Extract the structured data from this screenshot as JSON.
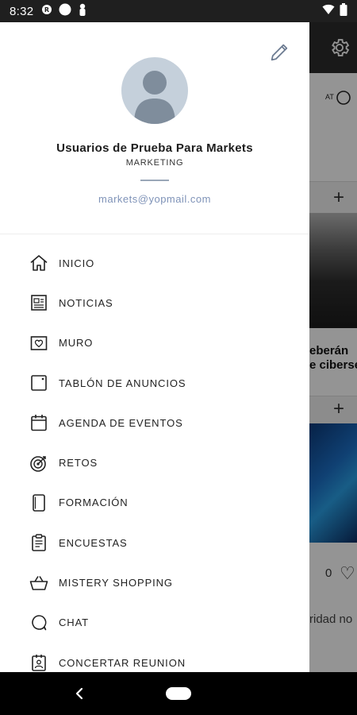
{
  "status_bar": {
    "time": "8:32"
  },
  "background_app": {
    "card_title_line1": "eberán",
    "card_title_line2": "e ciberse",
    "likes_count": "0",
    "snippet": "ridad no"
  },
  "drawer": {
    "user": {
      "name": "Usuarios de Prueba Para Markets",
      "department": "MARKETING",
      "email": "markets@yopmail.com"
    },
    "menu": [
      {
        "label": "INICIO",
        "icon": "home-icon"
      },
      {
        "label": "NOTICIAS",
        "icon": "newspaper-icon"
      },
      {
        "label": "MURO",
        "icon": "heart-frame-icon"
      },
      {
        "label": "TABLÓN DE ANUNCIOS",
        "icon": "board-icon"
      },
      {
        "label": "AGENDA DE EVENTOS",
        "icon": "calendar-icon"
      },
      {
        "label": "RETOS",
        "icon": "target-icon"
      },
      {
        "label": "FORMACIÓN",
        "icon": "tablet-icon"
      },
      {
        "label": "ENCUESTAS",
        "icon": "clipboard-icon"
      },
      {
        "label": "MISTERY SHOPPING",
        "icon": "basket-icon"
      },
      {
        "label": "CHAT",
        "icon": "chat-icon"
      },
      {
        "label": "CONCERTAR REUNION",
        "icon": "meeting-badge-icon"
      }
    ]
  }
}
